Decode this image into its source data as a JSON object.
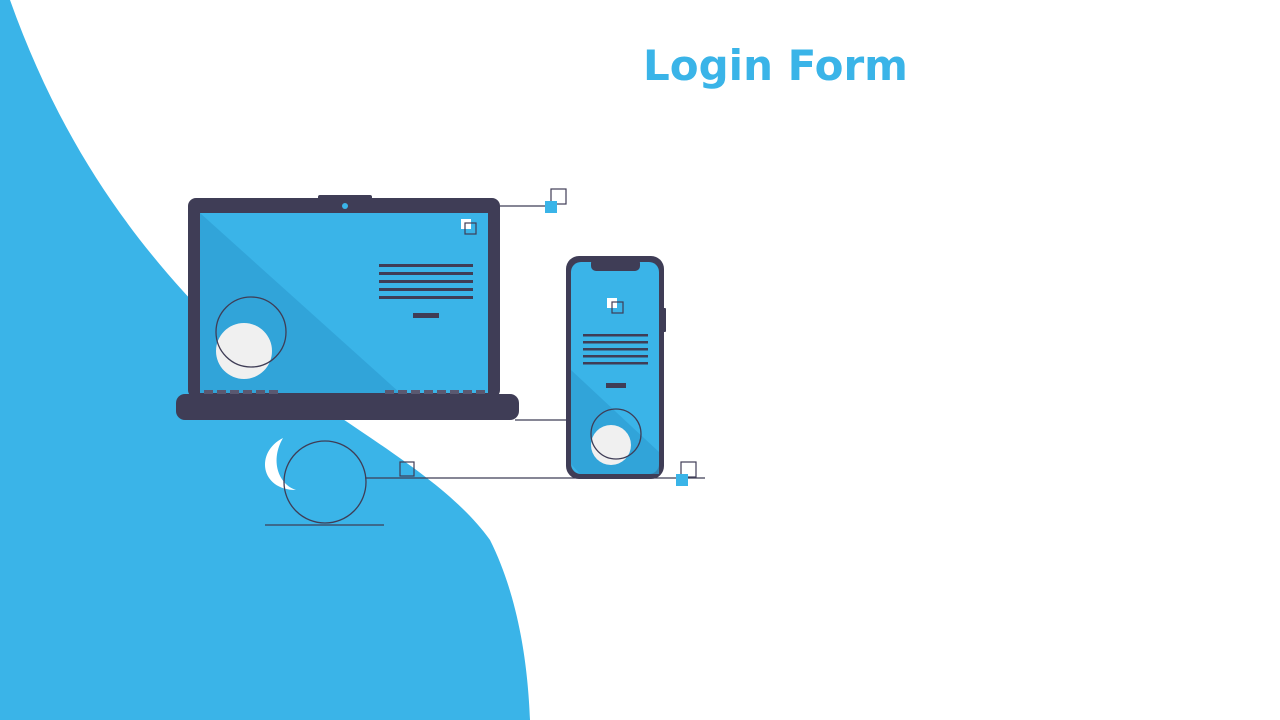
{
  "title": {
    "text": "Login Form"
  },
  "colors": {
    "accent": "#3ab4e8",
    "accent_dark": "#2f9fd4",
    "device_frame": "#3f3d56",
    "screen": "#3ab4e8",
    "circle_fill": "#f0f0f0",
    "background": "#ffffff"
  },
  "icons": {
    "laptop": "laptop-icon",
    "phone": "smartphone-icon"
  }
}
